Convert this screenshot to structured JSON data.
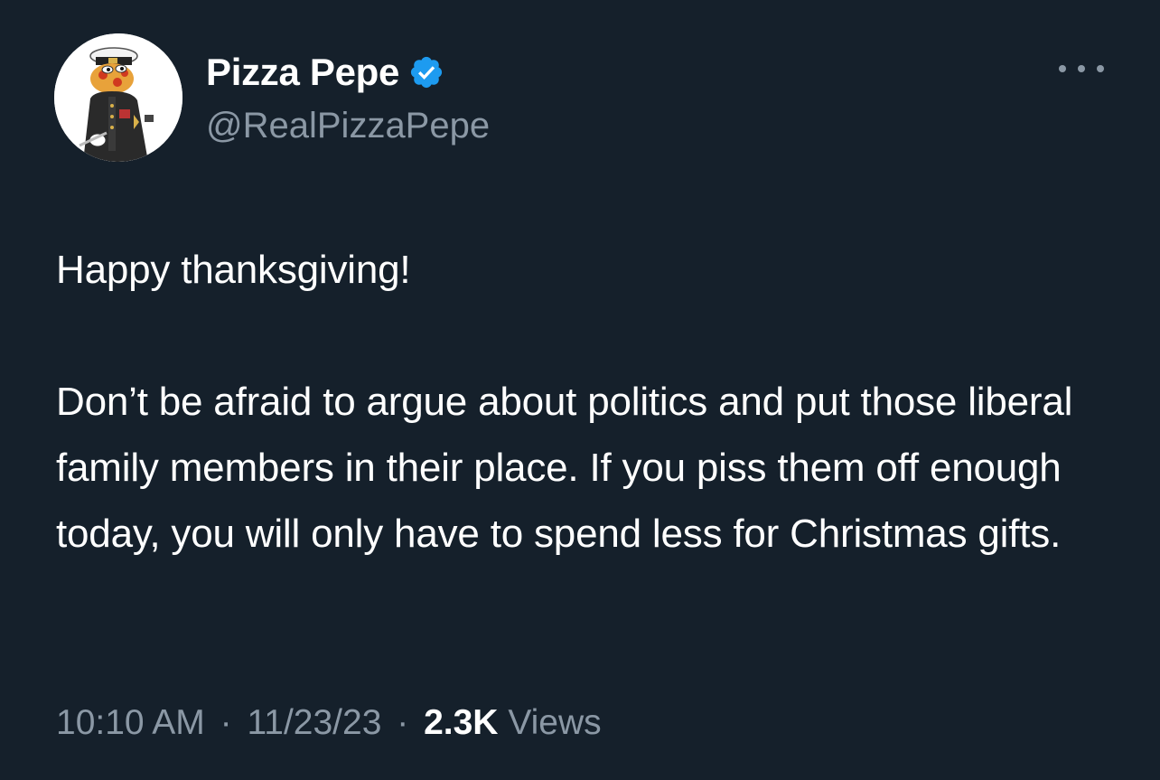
{
  "tweet": {
    "author": {
      "display_name": "Pizza Pepe",
      "handle": "@RealPizzaPepe",
      "verified": true,
      "avatar_icon": "pepe-pizza-captain-avatar"
    },
    "text": "Happy thanksgiving!\n\nDon’t be afraid to argue about politics and put those liberal family members in their place. If you piss them off enough today, you will only have to spend less for Christmas gifts.",
    "time": "10:10 AM",
    "date": "11/23/23",
    "separator": "·",
    "views_count": "2.3K",
    "views_label": "Views"
  },
  "colors": {
    "background": "#15202b",
    "text_primary": "#ffffff",
    "text_secondary": "#8b98a5",
    "verified_blue": "#1d9bf0"
  },
  "icons": {
    "verified": "verified-badge-icon",
    "more": "more-options-icon"
  }
}
